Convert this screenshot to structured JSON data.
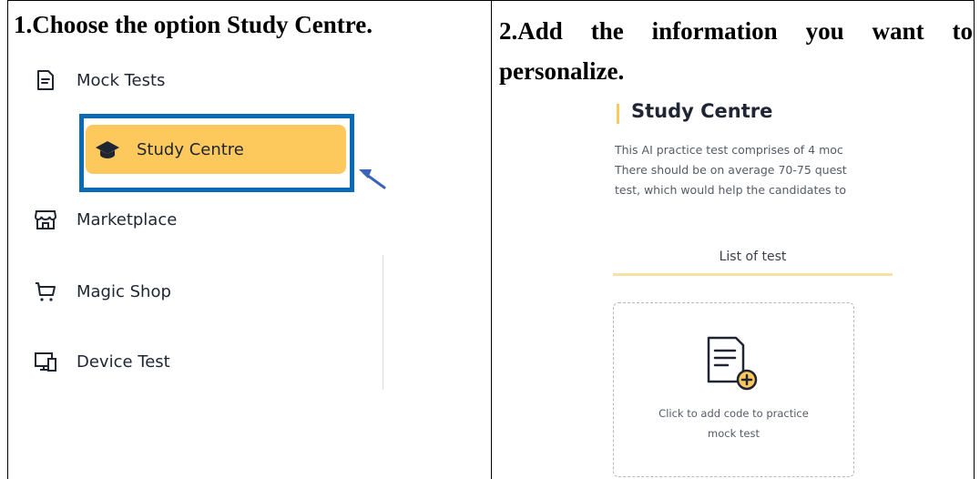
{
  "steps": {
    "step1": "1.Choose the option Study Centre.",
    "step2_line1": "2.Add the information you want to",
    "step2_line2": "personalize."
  },
  "sidebar": {
    "items": [
      {
        "label": "Mock Tests",
        "icon": "document-icon"
      },
      {
        "label": "Study Centre",
        "icon": "graduation-cap-icon",
        "selected": true
      },
      {
        "label": "Marketplace",
        "icon": "store-icon"
      },
      {
        "label": "Magic Shop",
        "icon": "cart-icon"
      },
      {
        "label": "Device Test",
        "icon": "monitor-icon"
      }
    ]
  },
  "study_centre": {
    "title": "Study Centre",
    "description_lines": [
      "This AI practice test comprises of 4 moc",
      "There should be on average 70-75 quest",
      "test, which would help the candidates to"
    ],
    "tab_label": "List of test",
    "add_card": {
      "caption_line1": "Click to add code to practice",
      "caption_line2": "mock test"
    }
  },
  "colors": {
    "highlight_border": "#0a6ab6",
    "accent_yellow": "#fec95c",
    "text_dark": "#1f2533"
  }
}
